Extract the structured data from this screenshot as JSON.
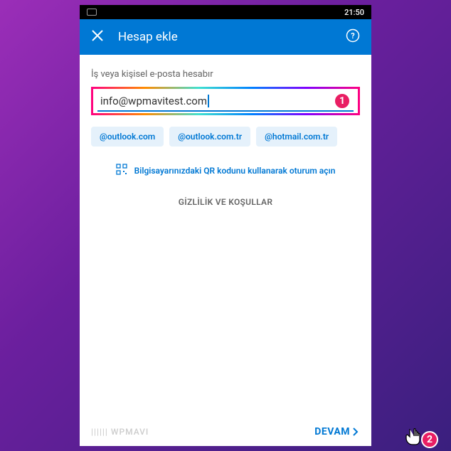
{
  "statusBar": {
    "time": "21:50"
  },
  "header": {
    "title": "Hesap ekle"
  },
  "form": {
    "label": "İş veya kişisel e-posta hesabır",
    "emailValue": "info@wpmavitest.com"
  },
  "suggestions": [
    "@outlook.com",
    "@outlook.com.tr",
    "@hotmail.com.tr"
  ],
  "qrText": "Bilgisayarınızdaki QR kodunu kullanarak oturum açın",
  "privacyText": "GİZLİLİK VE KOŞULLAR",
  "watermark": "|||||| WPMAVI",
  "continueLabel": "DEVAM",
  "callouts": {
    "one": "1",
    "two": "2"
  }
}
